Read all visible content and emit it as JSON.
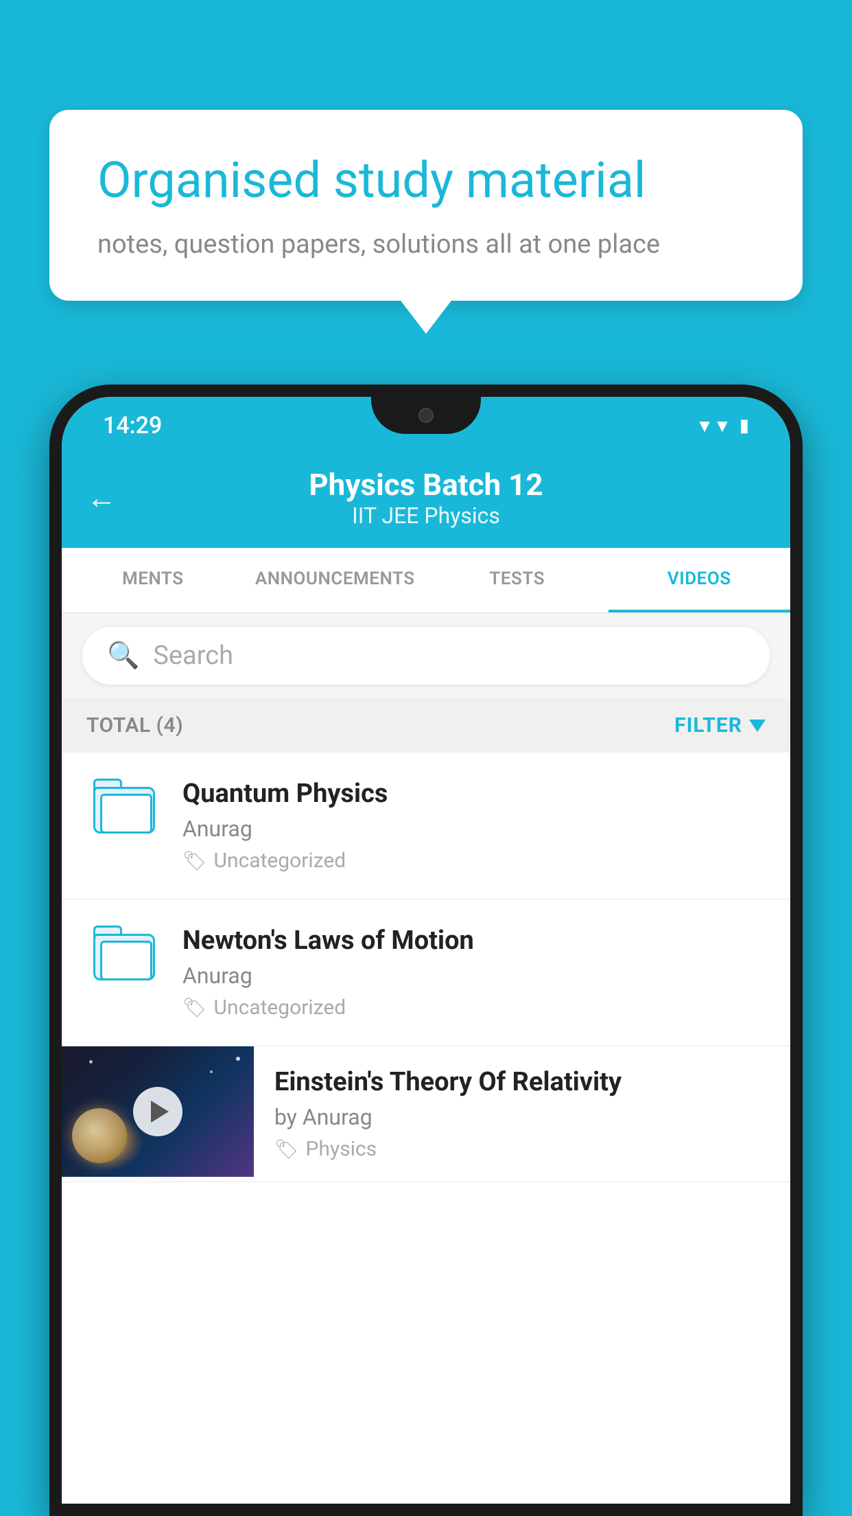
{
  "page": {
    "background_color": "#1ab8d8"
  },
  "speech_bubble": {
    "title": "Organised study material",
    "subtitle": "notes, question papers, solutions all at one place"
  },
  "phone": {
    "status_bar": {
      "time": "14:29",
      "icons": [
        "wifi",
        "signal",
        "battery"
      ]
    },
    "app_header": {
      "back_label": "←",
      "title": "Physics Batch 12",
      "subtitle": "IIT JEE   Physics"
    },
    "tabs": [
      {
        "label": "MENTS",
        "active": false
      },
      {
        "label": "ANNOUNCEMENTS",
        "active": false
      },
      {
        "label": "TESTS",
        "active": false
      },
      {
        "label": "VIDEOS",
        "active": true
      }
    ],
    "search": {
      "placeholder": "Search"
    },
    "filter_bar": {
      "total_label": "TOTAL (4)",
      "filter_label": "FILTER"
    },
    "videos": [
      {
        "id": 1,
        "title": "Quantum Physics",
        "author": "Anurag",
        "tag": "Uncategorized",
        "type": "folder"
      },
      {
        "id": 2,
        "title": "Newton's Laws of Motion",
        "author": "Anurag",
        "tag": "Uncategorized",
        "type": "folder"
      },
      {
        "id": 3,
        "title": "Einstein's Theory Of Relativity",
        "author": "by Anurag",
        "tag": "Physics",
        "type": "video"
      }
    ]
  }
}
